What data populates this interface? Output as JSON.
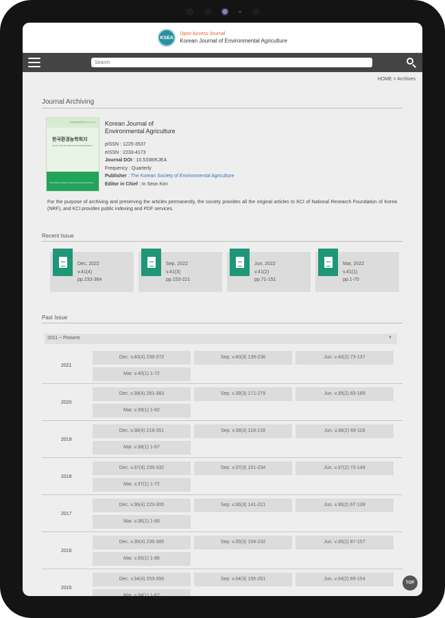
{
  "header": {
    "logo_badge": "KSEA",
    "logo_open_access": "Open Access Journal",
    "logo_title": "Korean Journal of Environmental Agriculture"
  },
  "navbar": {
    "menu_icon": "hamburger-menu-icon",
    "search_placeholder": "Search",
    "search_icon": "search-icon"
  },
  "breadcrumb": "HOME > Archives",
  "page_title": "Journal Archiving",
  "journal": {
    "cover": {
      "top_text": "한국환경농학회지 Vol.41 No.4",
      "title_kr": "한국환경농학회지",
      "title_en": "Korean Journal of Environmental Agriculture",
      "publisher_text": "The Korean Society of Environmental Agriculture",
      "accent_color": "#23a35b"
    },
    "title_line1": "Korean Journal of",
    "title_line2": "Environmental Agriculture",
    "pissn": "pISSN : 1225-3537",
    "eissn": "eISSN : 2233-4173",
    "doi_label": "Journal DOI",
    "doi_value": " : 10.5338/KJEA",
    "frequency": "Frequency : Quarterly",
    "publisher_label": "Publisher",
    "publisher_sep": " : ",
    "publisher_value": "The Korean Society of Environmental Agriculture",
    "editor_label": "Editor in Chief",
    "editor_value": " : In Seon Kim"
  },
  "description": "For the purpose of archiving and preserving the articles permanently, the society provides all the original articles to KCI of National Research Foundation of Korea (NRF), and KCI provides public indexing and PDF services.",
  "recent_issue": {
    "title": "Recent Issue",
    "cards": [
      {
        "date": "Dec, 2022",
        "vol": "v.41(4)",
        "pages": "pp.233-364"
      },
      {
        "date": "Sep, 2022",
        "vol": "v.41(3)",
        "pages": "pp.153-221"
      },
      {
        "date": "Jun, 2022",
        "vol": "v.41(2)",
        "pages": "pp.71-151"
      },
      {
        "date": "Mar, 2022",
        "vol": "v.41(1)",
        "pages": "pp.1-70"
      }
    ]
  },
  "past_issue": {
    "title": "Past Issue",
    "range": "2011 ~ Present",
    "years": [
      {
        "year": "2021",
        "issues": [
          "Dec. v.40(4) 239-372",
          "Sep. v.40(3) 139-238",
          "Jun. v.40(2) 73-137",
          "Mar. v.40(1) 1-72"
        ]
      },
      {
        "year": "2020",
        "issues": [
          "Dec. v.39(4) 281-383",
          "Sep. v.39(3) 171-279",
          "Jun. v.39(2) 83-169",
          "Mar. v.39(1) 1-82"
        ]
      },
      {
        "year": "2019",
        "issues": [
          "Dec. v.38(4) 219-351",
          "Sep. v.38(3) 119-218",
          "Jun. v.38(2) 69-118",
          "Mar. v.38(1) 1-67"
        ]
      },
      {
        "year": "2018",
        "issues": [
          "Dec. v.37(4) 235-332",
          "Sep. v.37(3) 151-234",
          "Jun. v.37(2) 73-149",
          "Mar. v.37(1) 1-72"
        ]
      },
      {
        "year": "2017",
        "issues": [
          "Dec. v.36(4) 223-305",
          "Sep. v.36(3) 141-221",
          "Jun. v.36(2) 67-139",
          "Mar. v.36(1) 1-66"
        ]
      },
      {
        "year": "2016",
        "issues": [
          "Dec. v.35(4) 235-385",
          "Sep. v.35(3) 159-232",
          "Jun. v.35(2) 87-157",
          "Mar. v.35(1) 1-86"
        ]
      },
      {
        "year": "2015",
        "issues": [
          "Dec. v.34(4) 253-356",
          "Sep. v.34(3) 155-251",
          "Jun. v.34(2) 69-154",
          "Mar. v.34(1) 1-67"
        ]
      }
    ]
  },
  "top_button": "TOP"
}
